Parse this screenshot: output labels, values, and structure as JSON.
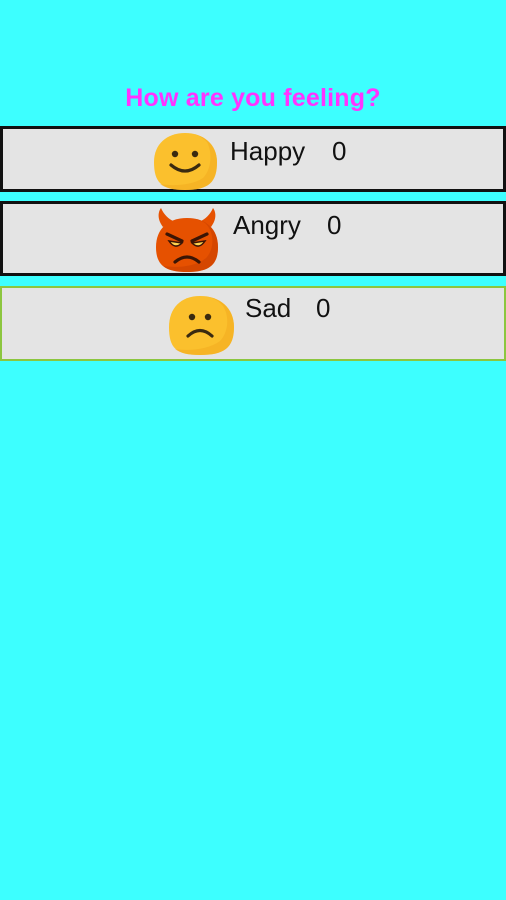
{
  "header": {
    "title": "How are you feeling?"
  },
  "moods": [
    {
      "label": "Happy",
      "count": "0",
      "icon": "happy-face-icon"
    },
    {
      "label": "Angry",
      "count": "0",
      "icon": "angry-devil-face-icon"
    },
    {
      "label": "Sad",
      "count": "0",
      "icon": "sad-face-icon"
    }
  ],
  "colors": {
    "background": "#3dffff",
    "title": "#ff33ff",
    "button_background": "#e4e4e4",
    "button_border": "#111111",
    "selected_border": "#8cc63f",
    "emoji_yellow": "#fbc02d",
    "emoji_red": "#e65100"
  }
}
